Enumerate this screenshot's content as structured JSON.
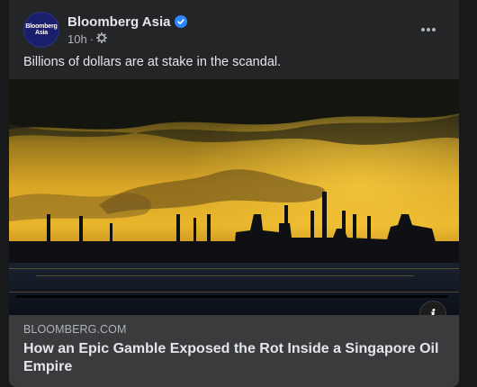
{
  "post": {
    "page_name": "Bloomberg Asia",
    "avatar_text_line1": "Bloomberg",
    "avatar_text_line2": "Asia",
    "timestamp": "10h",
    "separator": "·",
    "privacy_icon": "gear-icon",
    "more_icon": "more-horizontal-icon",
    "verified_icon": "verified-badge-icon",
    "text": "Billions of dollars are at stake in the scandal.",
    "colors": {
      "verified": "#2d88ff",
      "card": "#242526",
      "link_bar": "#3a3b3c"
    }
  },
  "link_preview": {
    "domain": "BLOOMBERG.COM",
    "title": "How an Epic Gamble Exposed the Rot Inside a Singapore Oil Empire",
    "info_icon": "info-icon"
  }
}
